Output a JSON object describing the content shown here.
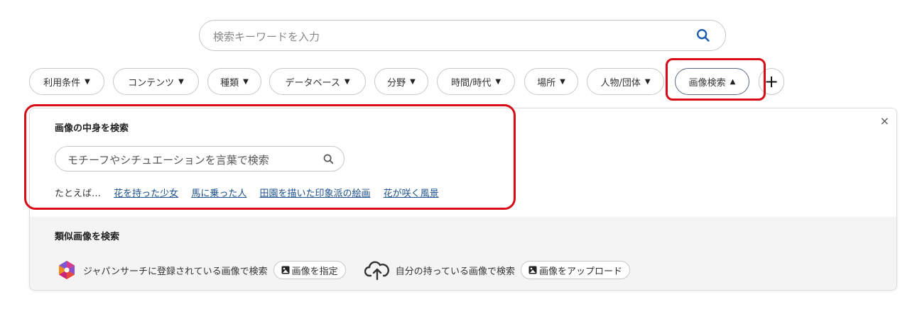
{
  "search": {
    "placeholder": "検索キーワードを入力",
    "icon": "search-icon"
  },
  "filters": [
    {
      "label": "利用条件",
      "caret": "▼"
    },
    {
      "label": "コンテンツ",
      "caret": "▼"
    },
    {
      "label": "種類",
      "caret": "▼"
    },
    {
      "label": "データベース",
      "caret": "▼"
    },
    {
      "label": "分野",
      "caret": "▼"
    },
    {
      "label": "時間/時代",
      "caret": "▼"
    },
    {
      "label": "場所",
      "caret": "▼"
    },
    {
      "label": "人物/団体",
      "caret": "▼"
    },
    {
      "label": "画像検索",
      "caret": "▲"
    }
  ],
  "add_filter": {
    "label": "+"
  },
  "panel": {
    "close_label": "×",
    "content_search": {
      "title": "画像の中身を検索",
      "placeholder": "モチーフやシチュエーションを言葉で検索",
      "examples_prefix": "たとえば…",
      "examples": [
        "花を持った少女",
        "馬に乗った人",
        "田園を描いた印象派の絵画",
        "花が咲く風景"
      ]
    },
    "similar_search": {
      "title": "類似画像を検索",
      "registered_text": "ジャパンサーチに登録されている画像で検索",
      "registered_button": "画像を指定",
      "upload_text": "自分の持っている画像で検索",
      "upload_button": "画像をアップロード"
    }
  },
  "colors": {
    "highlight": "#d70c18",
    "link": "#1b4f8b",
    "active_border": "#5a6a82"
  }
}
